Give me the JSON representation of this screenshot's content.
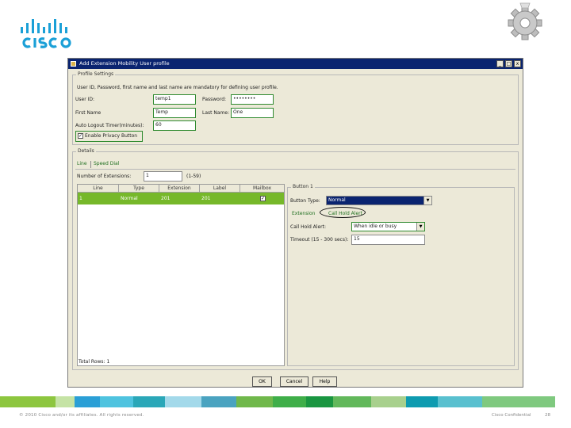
{
  "slide": {
    "copyright": "© 2010 Cisco and/or its affiliates. All rights reserved.",
    "confidential": "Cisco Confidential",
    "page_number": "28",
    "stripe_colors": [
      "#8dc63f",
      "#c5e3a5",
      "#2a9fd6",
      "#4fc3df",
      "#2aa7b8",
      "#a3d9ea",
      "#4aa3c0",
      "#70b84b",
      "#3fae49",
      "#1a9641",
      "#62b85b",
      "#a8d08d",
      "#0e9bb0",
      "#59c0cf",
      "#7fc97f"
    ]
  },
  "dialog": {
    "title": "Add Extension Mobility User profile",
    "minimize": "_",
    "maximize": "□",
    "close": "x",
    "profile_settings": {
      "group_title": "Profile Settings",
      "note": "User ID, Password, first name and last name are mandatory for defining user profile.",
      "user_id_label": "User ID:",
      "user_id_value": "temp1",
      "password_label": "Password:",
      "password_value": "••••••••",
      "first_name_label": "First Name",
      "first_name_value": "Temp",
      "last_name_label": "Last Name:",
      "last_name_value": "One",
      "auto_logout_label": "Auto Logout Timer(minutes):",
      "auto_logout_value": "60",
      "privacy_label": "Enable Privacy Button",
      "privacy_checked": "✓"
    },
    "details": {
      "group_title": "Details",
      "tabs": [
        "Line",
        "Speed Dial"
      ],
      "num_ext_label": "Number of Extensions:",
      "num_ext_value": "1",
      "num_ext_range": "(1-59)",
      "table": {
        "headers": [
          "Line",
          "Type",
          "Extension",
          "Label",
          "Mailbox"
        ],
        "rows": [
          {
            "line": "1",
            "type": "Normal",
            "extension": "201",
            "label": "201",
            "mailbox": "✓"
          }
        ],
        "totals": "Total Rows: 1"
      },
      "button1": {
        "group_title": "Button 1",
        "button_type_label": "Button Type:",
        "button_type_value": "Normal",
        "subtabs": [
          "Extension",
          "Call Hold Alert"
        ],
        "call_hold_label": "Call Hold Alert:",
        "call_hold_value": "When idle or busy",
        "timeout_label": "Timeout (15 - 300 secs):",
        "timeout_value": "15"
      }
    },
    "footer": {
      "ok": "OK",
      "cancel": "Cancel",
      "help": "Help"
    }
  }
}
